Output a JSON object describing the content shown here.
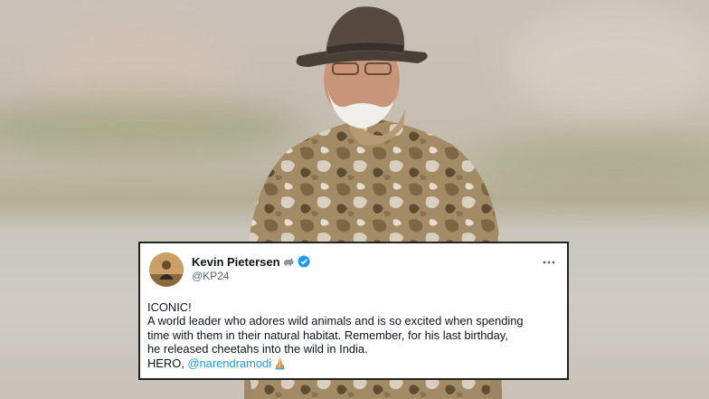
{
  "tweet": {
    "display_name": "Kevin Pietersen",
    "name_emoji_icon": "rhino-icon",
    "verified_icon": "verified-badge-icon",
    "handle": "@KP24",
    "more_icon": "more-options-icon",
    "lines": [
      "ICONIC!",
      "A world leader who adores wild animals and is so excited when spending",
      "time with them in their natural habitat. Remember, for his last birthday,",
      "he released cheetahs into the wild in India."
    ],
    "last_line_prefix": "HERO, ",
    "mention": "@narendramodi",
    "trailing_emoji_icon": "folded-hands-icon"
  },
  "colors": {
    "mention": "#1d9bf0",
    "verified": "#1d9bf0",
    "text": "#0f1419",
    "secondary_text": "#536471",
    "card_border": "#222222"
  }
}
